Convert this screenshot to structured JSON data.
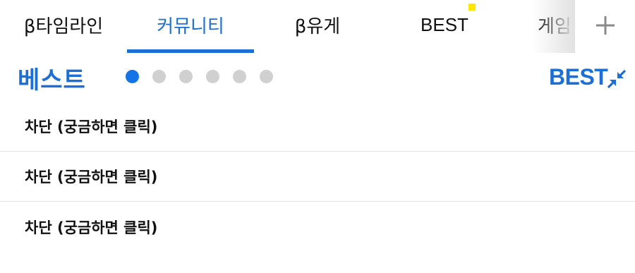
{
  "tabs": [
    {
      "label": "β타임라인",
      "active": false
    },
    {
      "label": "커뮤니티",
      "active": true
    },
    {
      "label": "β유게",
      "active": false
    },
    {
      "label": "BEST",
      "active": false,
      "badge": true
    },
    {
      "label": "게임",
      "active": false
    }
  ],
  "colors": {
    "accent": "#1c6fd6",
    "badge": "#ffe600",
    "dot_inactive": "#d0d0d0"
  },
  "best_section": {
    "title": "베스트",
    "link_label": "BEST",
    "pager": {
      "total": 6,
      "current": 1
    }
  },
  "list": {
    "items": [
      {
        "text": "차단 (궁금하면 클릭)"
      },
      {
        "text": "차단 (궁금하면 클릭)"
      },
      {
        "text": "차단 (궁금하면 클릭)"
      }
    ]
  },
  "icons": {
    "add": "plus-icon",
    "collapse": "collapse-arrows-icon"
  }
}
